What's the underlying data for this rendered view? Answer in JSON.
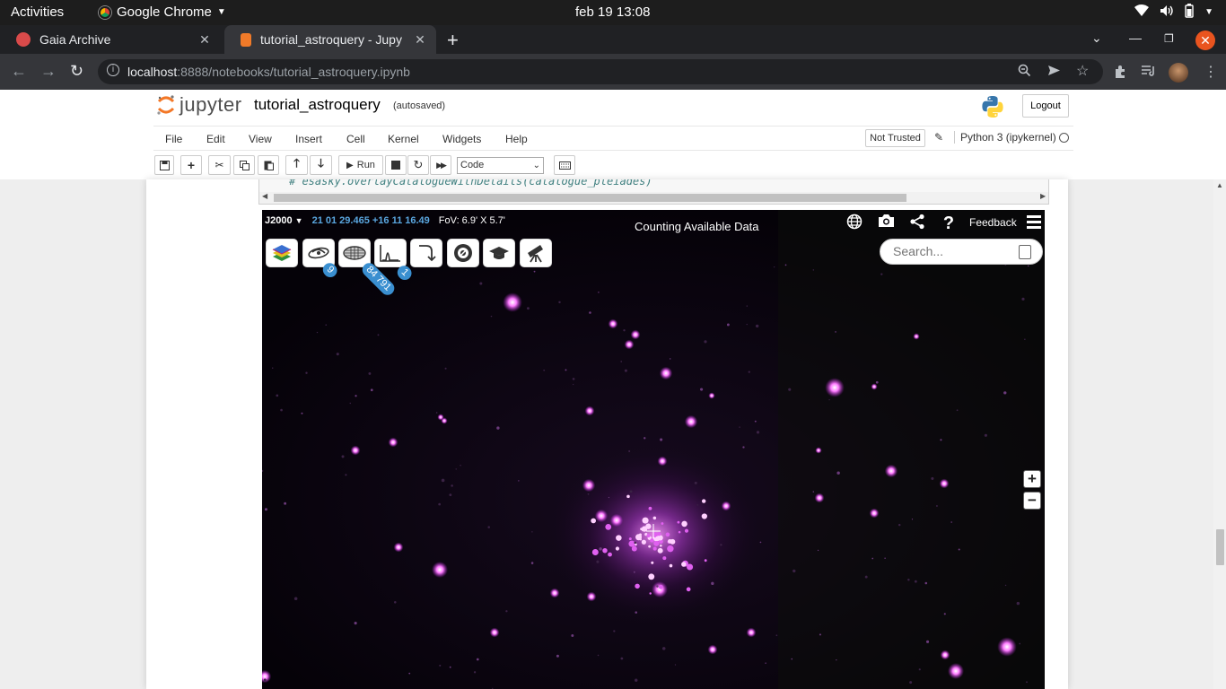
{
  "system_bar": {
    "activities": "Activities",
    "app_name": "Google Chrome",
    "clock": "feb 19  13:08"
  },
  "browser": {
    "tabs": [
      {
        "title": "Gaia Archive",
        "active": false,
        "favicon_color": "#d94a4a"
      },
      {
        "title": "tutorial_astroquery - Jupy",
        "active": true,
        "favicon_color": "#f07a29"
      }
    ],
    "url_host": "localhost",
    "url_path": ":8888/notebooks/tutorial_astroquery.ipynb"
  },
  "jupyter": {
    "logo_text": "jupyter",
    "notebook_name": "tutorial_astroquery",
    "autosave_status": "(autosaved)",
    "logout_label": "Logout",
    "menus": [
      "File",
      "Edit",
      "View",
      "Insert",
      "Cell",
      "Kernel",
      "Widgets",
      "Help"
    ],
    "trust_label": "Not Trusted",
    "kernel_name": "Python 3 (ipykernel)",
    "run_label": "Run",
    "cell_type": "Code",
    "code_line": "# esasky.overlayCatalogueWithDetails(catalogue_pleiades)"
  },
  "esasky": {
    "coord_frame": "J2000",
    "coordinates": "21 01 29.465 +16 11 16.49",
    "fov": "FoV: 6.9' X 5.7'",
    "status": "Counting Available Data",
    "feedback_label": "Feedback",
    "search_placeholder": "Search...",
    "badges": {
      "galaxy": "9",
      "catalogues": "84 791",
      "spectra": "1"
    },
    "accent_color": "#3a8fd0"
  }
}
